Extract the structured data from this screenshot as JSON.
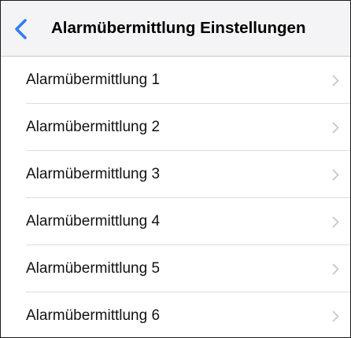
{
  "navbar": {
    "back_icon": "chevron-left-icon",
    "title": "Alarmübermittlung Einstellungen",
    "accent_color": "#2f7cf6"
  },
  "list": {
    "chevron_icon": "chevron-right-icon",
    "chevron_color": "#c7c7cc",
    "items": [
      {
        "label": "Alarmübermittlung 1"
      },
      {
        "label": "Alarmübermittlung 2"
      },
      {
        "label": "Alarmübermittlung 3"
      },
      {
        "label": "Alarmübermittlung 4"
      },
      {
        "label": "Alarmübermittlung 5"
      },
      {
        "label": "Alarmübermittlung 6"
      }
    ]
  }
}
